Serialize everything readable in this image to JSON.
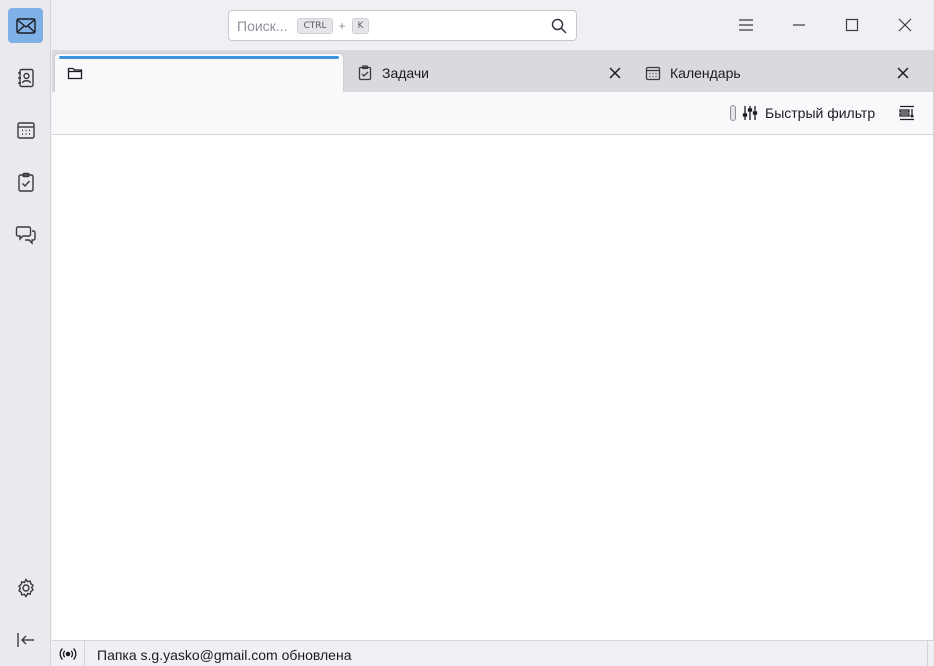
{
  "search": {
    "placeholder": "Поиск...",
    "shortcut_mod": "CTRL",
    "shortcut_plus": "+",
    "shortcut_key": "K"
  },
  "spaces": [
    {
      "name": "mail",
      "icon": "mail-icon",
      "active": true
    },
    {
      "name": "address-book",
      "icon": "address-book-icon",
      "active": false
    },
    {
      "name": "calendar",
      "icon": "calendar-icon",
      "active": false
    },
    {
      "name": "tasks",
      "icon": "tasks-icon",
      "active": false
    },
    {
      "name": "chat",
      "icon": "chat-icon",
      "active": false
    },
    {
      "name": "settings",
      "icon": "gear-icon",
      "active": false
    },
    {
      "name": "collapse",
      "icon": "collapse-left-icon",
      "active": false
    }
  ],
  "tabs": [
    {
      "label": "",
      "icon": "folder-icon",
      "active": true
    },
    {
      "label": "Задачи",
      "icon": "tasks-icon",
      "active": false
    },
    {
      "label": "Календарь",
      "icon": "calendar-icon",
      "active": false
    }
  ],
  "filterbar": {
    "quick_filter_label": "Быстрый фильтр"
  },
  "status": {
    "message": "Папка s.g.yasko@gmail.com обновлена"
  },
  "colors": {
    "accent": "#3d94dc",
    "active_space": "#7fb1e6"
  }
}
